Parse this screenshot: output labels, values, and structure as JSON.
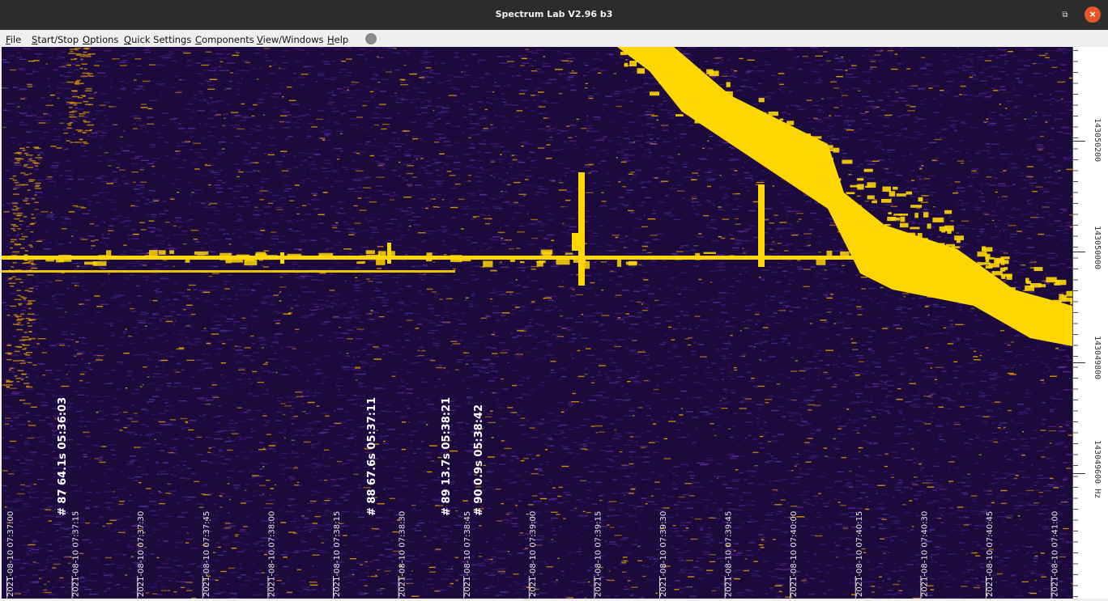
{
  "window": {
    "title": "Spectrum Lab V2.96 b3",
    "restore_icon": "restore-icon",
    "close_icon": "close-icon",
    "close_glyph": "×",
    "restore_glyph": "⧉"
  },
  "menu": [
    {
      "label": "File",
      "mnemonic": "F"
    },
    {
      "label": "Start/Stop",
      "mnemonic": "S"
    },
    {
      "label": "Options",
      "mnemonic": "O"
    },
    {
      "label": "Quick Settings",
      "mnemonic": "Q"
    },
    {
      "label": "Components",
      "mnemonic": "C"
    },
    {
      "label": "View/Windows",
      "mnemonic": "V"
    },
    {
      "label": "Help",
      "mnemonic": "H"
    }
  ],
  "colors": {
    "background": "#1d0a3c",
    "noise": "#3b1b7a",
    "signal": "#ffd700",
    "signal_dim": "#e8a000"
  },
  "time_labels": [
    "2021-08-10 07:37:00",
    "2021-08-10 07:37:15",
    "2021-08-10 07:37:30",
    "2021-08-10 07:37:45",
    "2021-08-10 07:38:00",
    "2021-08-10 07:38:15",
    "2021-08-10 07:38:30",
    "2021-08-10 07:38:45",
    "2021-08-10 07:39:00",
    "2021-08-10 07:39:15",
    "2021-08-10 07:39:30",
    "2021-08-10 07:39:45",
    "2021-08-10 07:40:00",
    "2021-08-10 07:40:15",
    "2021-08-10 07:40:30",
    "2021-08-10 07:40:45",
    "2021-08-10 07:41:00"
  ],
  "events": [
    "# 87  64.1s  05:36:03",
    "# 88  67.6s  05:37:11",
    "# 89  13.7s  05:38:21",
    "# 90  0.9s  05:38:42"
  ],
  "frequency_labels": [
    "143050200",
    "143050000",
    "143049800",
    "143049600 Hz"
  ]
}
